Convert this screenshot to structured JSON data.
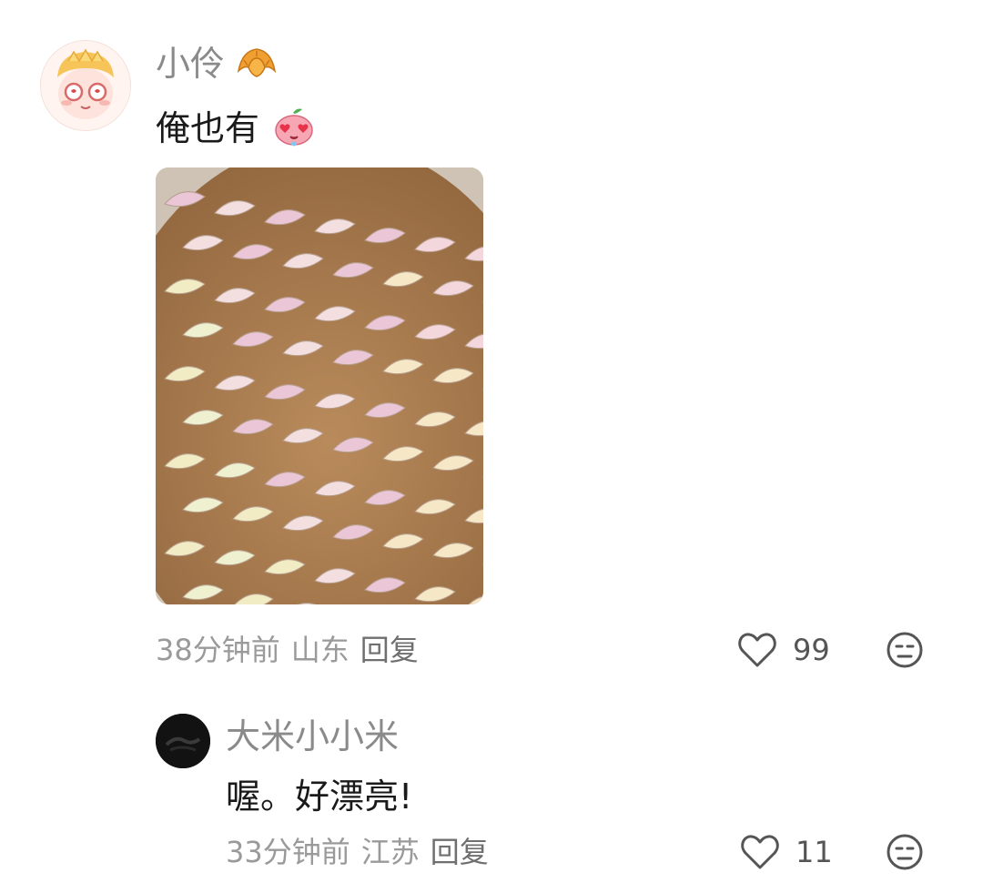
{
  "comments": [
    {
      "username": "小伶",
      "username_badge_icon": "croissant-icon",
      "text": "俺也有",
      "text_emoji_icon": "heart-eyes-peach-icon",
      "image_icon": "colorful-dumplings-photo",
      "time": "38分钟前",
      "location": "山东",
      "reply_label": "回复",
      "likes": "99"
    },
    {
      "username": "大米小小米",
      "text": "喔。好漂亮!",
      "time": "33分钟前",
      "location": "江苏",
      "reply_label": "回复",
      "likes": "11"
    }
  ],
  "colors": {
    "username": "#8a8a8a",
    "text": "#1a1a1a",
    "meta": "#9a9a9a",
    "icon": "#555555"
  }
}
